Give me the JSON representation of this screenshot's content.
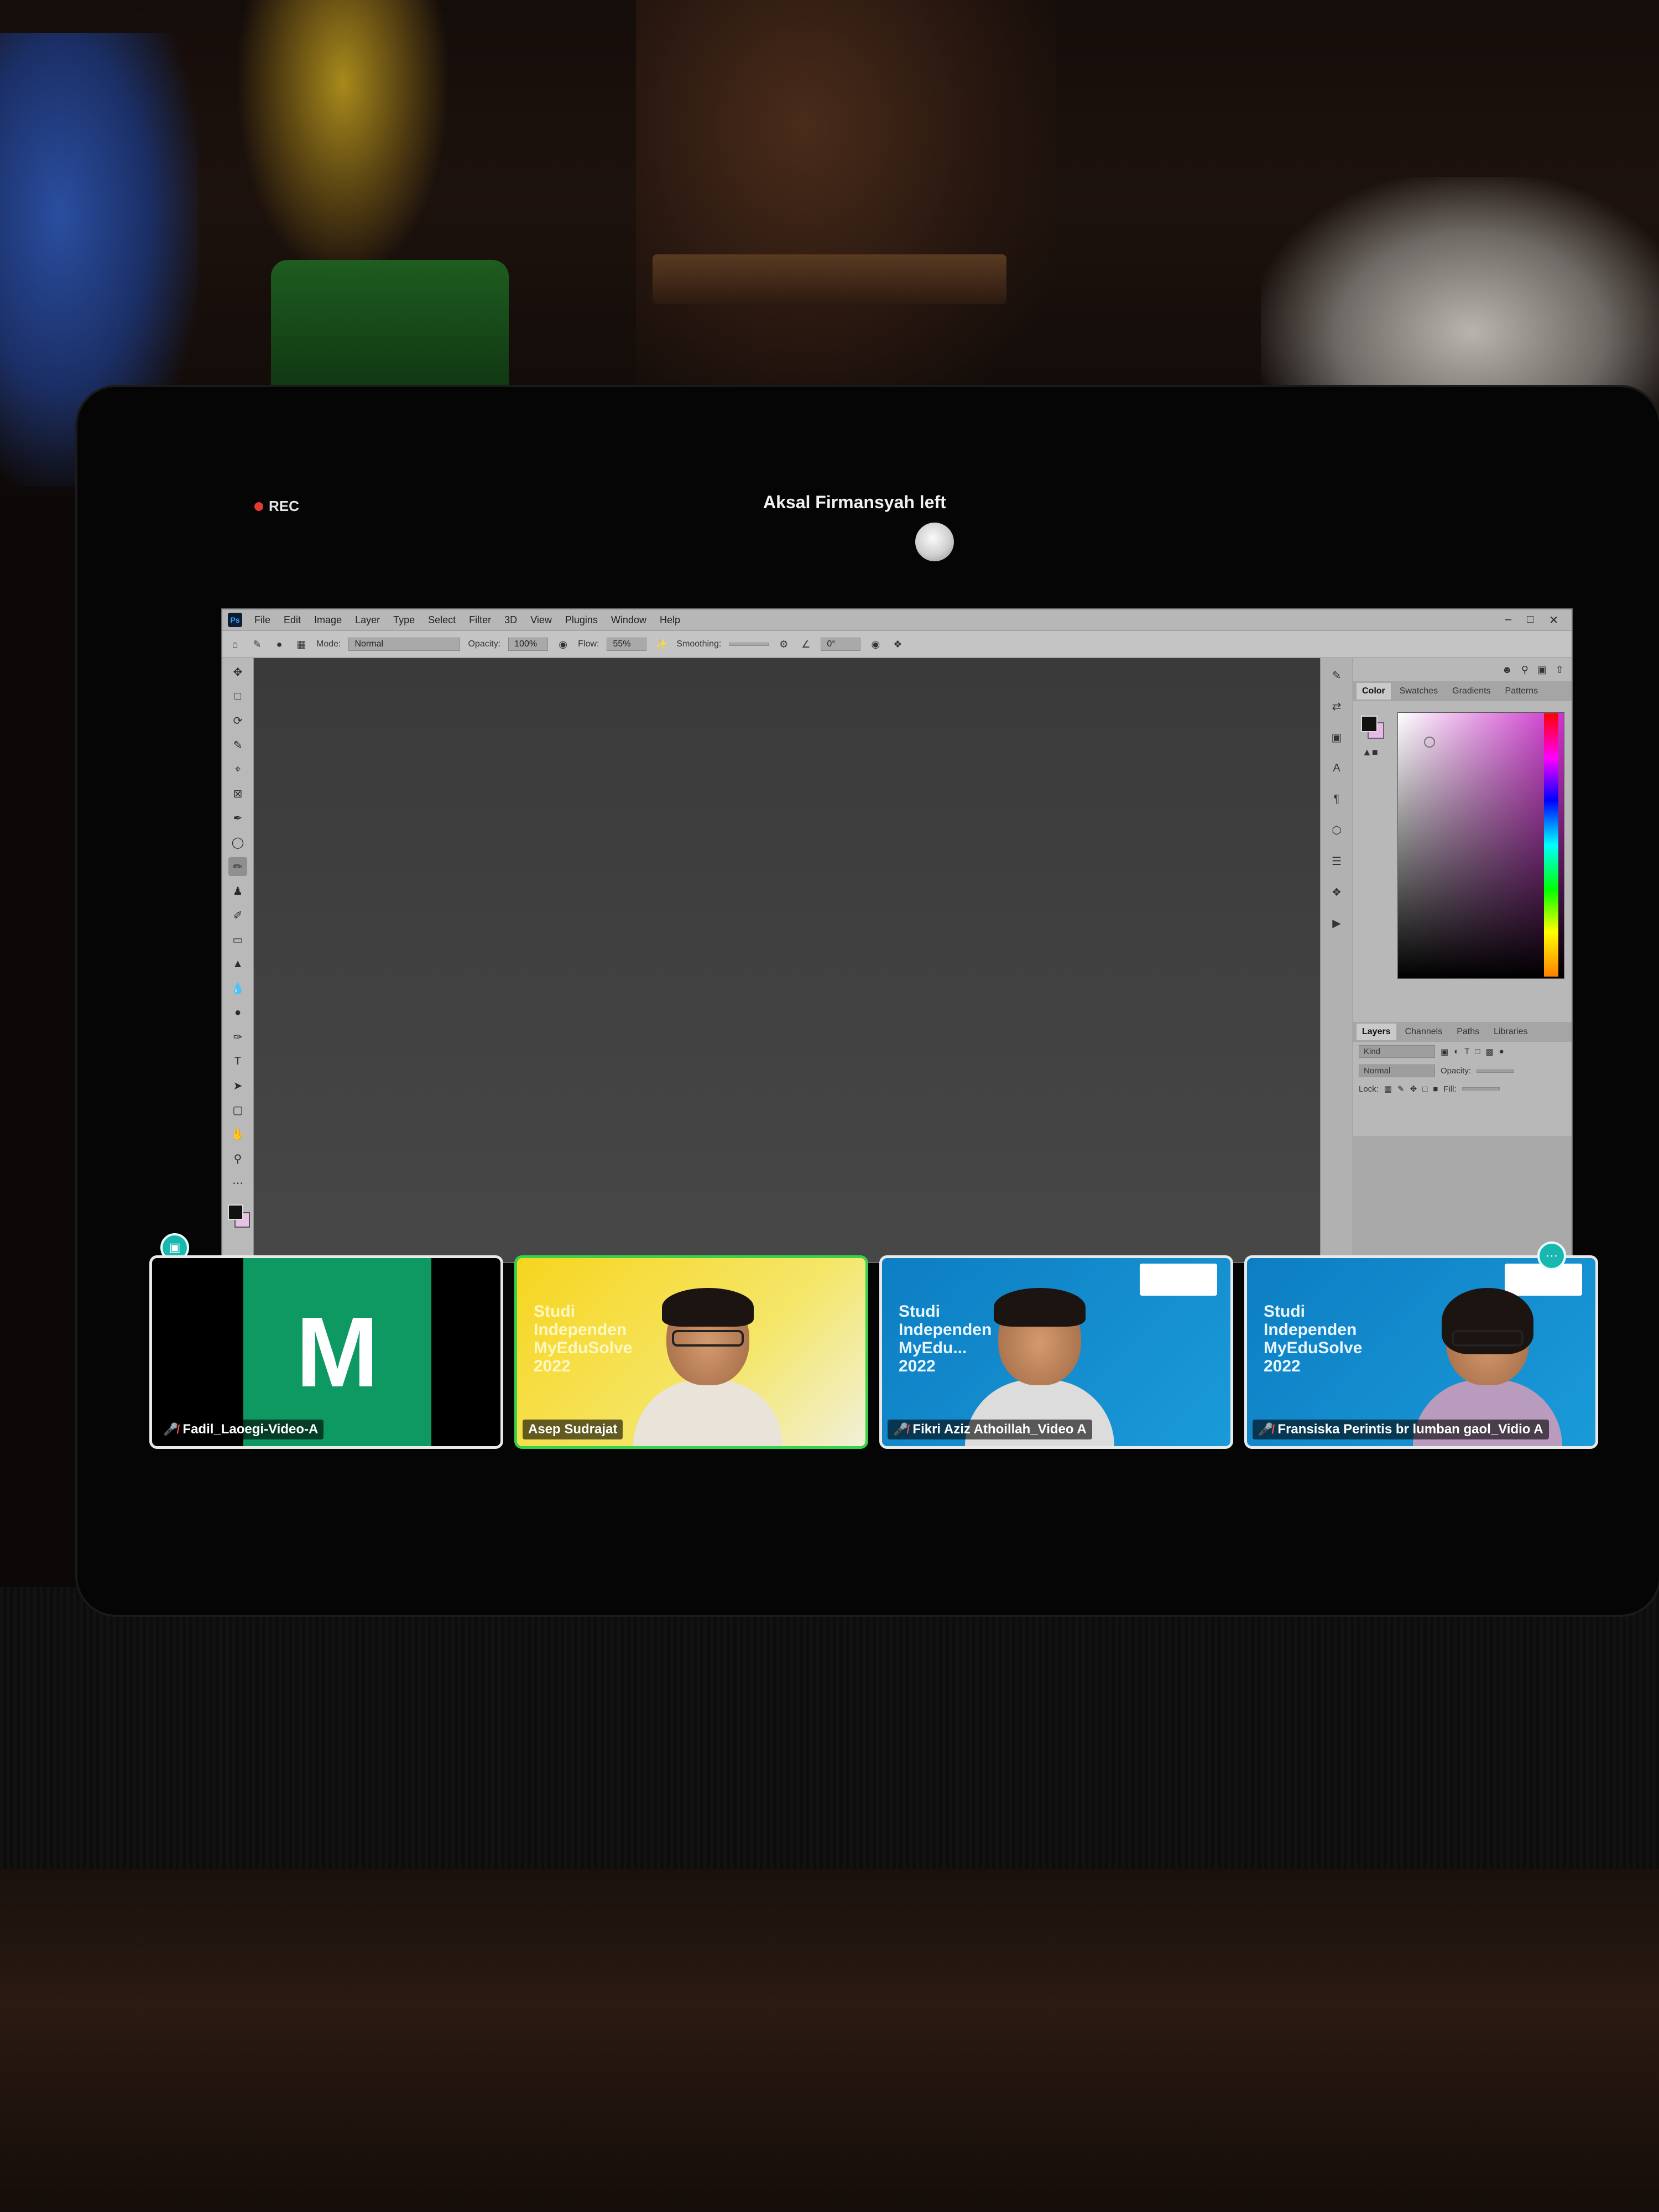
{
  "meeting": {
    "rec_label": "REC",
    "notification": "Aksal Firmansyah left"
  },
  "photoshop": {
    "app_icon": "Ps",
    "menu": [
      "File",
      "Edit",
      "Image",
      "Layer",
      "Type",
      "Select",
      "Filter",
      "3D",
      "View",
      "Plugins",
      "Window",
      "Help"
    ],
    "window_controls": [
      "minimize-icon",
      "maximize-icon",
      "close-icon"
    ],
    "options": {
      "mode_label": "Mode:",
      "mode_value": "Normal",
      "opacity_label": "Opacity:",
      "opacity_value": "100%",
      "flow_label": "Flow:",
      "flow_value": "55%",
      "smoothing_label": "Smoothing:",
      "angle_value": "0°"
    },
    "tools": [
      "move-tool",
      "marquee-tool",
      "lasso-tool",
      "quick-select-tool",
      "crop-tool",
      "frame-tool",
      "eyedropper-tool",
      "spot-heal-tool",
      "brush-tool",
      "clone-stamp-tool",
      "history-brush-tool",
      "eraser-tool",
      "gradient-tool",
      "blur-tool",
      "dodge-tool",
      "pen-tool",
      "type-tool",
      "path-select-tool",
      "rectangle-tool",
      "hand-tool",
      "zoom-tool",
      "more-tools"
    ],
    "active_tool": "brush-tool",
    "foreground_color": "#111111",
    "background_color": "#e6b9e9",
    "color_panel": {
      "tabs": [
        "Color",
        "Swatches",
        "Gradients",
        "Patterns"
      ],
      "active_tab": "Color",
      "hue_color": "#cc33cc"
    },
    "layers_panel": {
      "tabs": [
        "Layers",
        "Channels",
        "Paths",
        "Libraries"
      ],
      "active_tab": "Layers",
      "filter_placeholder": "Kind",
      "blend_mode": "Normal",
      "opacity_label": "Opacity:",
      "lock_label": "Lock:",
      "fill_label": "Fill:"
    }
  },
  "participants": [
    {
      "name": "Fadil_Laoegi-Video-A",
      "avatar_letter": "M",
      "muted": true,
      "speaking": false,
      "avatar_color": "#0e9963"
    },
    {
      "name": "Asep Sudrajat",
      "muted": false,
      "speaking": true,
      "background_text": "Studi Independen MyEduSolve 2022"
    },
    {
      "name": "Fikri Aziz Athoillah_Video A",
      "muted": true,
      "speaking": false,
      "background_text": "Studi Independen MyEdu... 2022"
    },
    {
      "name": "Fransiska Perintis br lumban gaol_Vidio A",
      "muted": true,
      "speaking": false,
      "background_text": "Studi Independen MyEduSolve 2022"
    }
  ]
}
